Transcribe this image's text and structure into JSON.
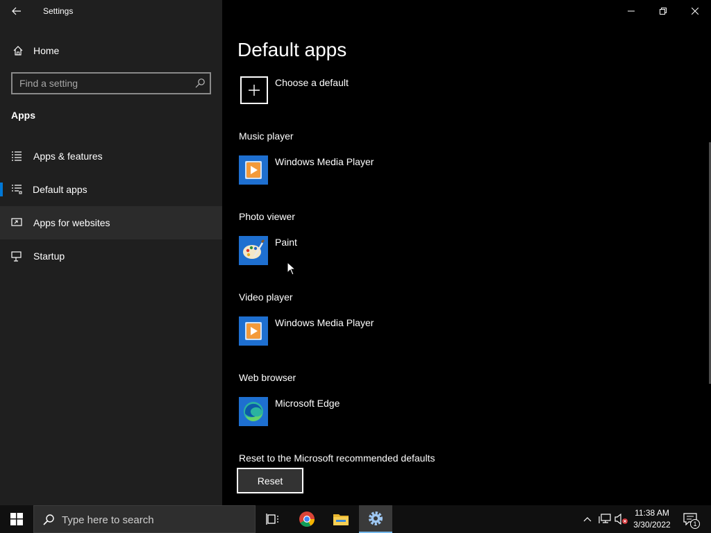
{
  "window": {
    "title": "Settings",
    "controls": {
      "minimize": "minimize-icon",
      "restore": "restore-icon",
      "close": "close-icon"
    }
  },
  "sidebar": {
    "home_label": "Home",
    "search": {
      "placeholder": "Find a setting",
      "value": ""
    },
    "section_heading": "Apps",
    "items": [
      {
        "label": "Apps & features",
        "icon": "apps-features-icon",
        "state": "normal"
      },
      {
        "label": "Default apps",
        "icon": "default-apps-icon",
        "state": "selected"
      },
      {
        "label": "Apps for websites",
        "icon": "apps-for-websites-icon",
        "state": "hover"
      },
      {
        "label": "Startup",
        "icon": "startup-icon",
        "state": "normal"
      }
    ]
  },
  "main": {
    "title": "Default apps",
    "choose_default_label": "Choose a default",
    "categories": [
      {
        "label": "Music player",
        "app": "Windows Media Player",
        "icon": "windows-media-player-icon"
      },
      {
        "label": "Photo viewer",
        "app": "Paint",
        "icon": "paint-icon"
      },
      {
        "label": "Video player",
        "app": "Windows Media Player",
        "icon": "windows-media-player-icon"
      },
      {
        "label": "Web browser",
        "app": "Microsoft Edge",
        "icon": "microsoft-edge-icon"
      }
    ],
    "reset_caption": "Reset to the Microsoft recommended defaults",
    "reset_button": "Reset"
  },
  "taskbar": {
    "search_placeholder": "Type here to search",
    "apps": [
      "task-view-icon",
      "chrome-icon",
      "file-explorer-icon",
      "settings-icon"
    ],
    "clock_time": "11:38 AM",
    "clock_date": "3/30/2022",
    "notification_count": "1"
  },
  "colors": {
    "accent": "#0078d7",
    "sidebar_bg": "#1f1f1f",
    "main_bg": "#000000",
    "taskbar_bg": "#101010"
  }
}
